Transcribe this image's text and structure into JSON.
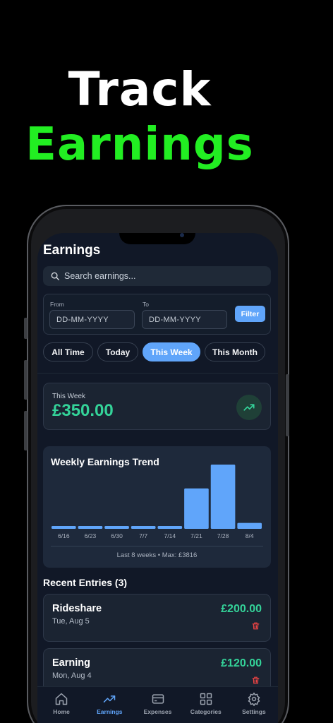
{
  "promo": {
    "line1": "Track",
    "line2": "Earnings"
  },
  "app": {
    "title": "Earnings",
    "search_placeholder": "Search earnings..."
  },
  "date_filter": {
    "from_label": "From",
    "from_value": "DD-MM-YYYY",
    "to_label": "To",
    "to_value": "DD-MM-YYYY",
    "filter_button": "Filter"
  },
  "chips": [
    {
      "label": "All Time",
      "active": false
    },
    {
      "label": "Today",
      "active": false
    },
    {
      "label": "This Week",
      "active": true
    },
    {
      "label": "This Month",
      "active": false
    }
  ],
  "summary": {
    "label": "This Week",
    "amount": "£350.00",
    "icon": "trending-up-icon"
  },
  "chart_data": {
    "type": "bar",
    "title": "Weekly Earnings Trend",
    "categories": [
      "6/16",
      "6/23",
      "6/30",
      "7/7",
      "7/14",
      "7/21",
      "7/28",
      "8/4"
    ],
    "values": [
      150,
      150,
      150,
      150,
      150,
      2400,
      3816,
      350
    ],
    "ylim": [
      0,
      3816
    ],
    "footer": "Last 8 weeks • Max: £3816",
    "bar_color": "#60a5fa"
  },
  "recent": {
    "title": "Recent Entries (3)",
    "entries": [
      {
        "name": "Rideshare",
        "date": "Tue, Aug 5",
        "amount": "£200.00"
      },
      {
        "name": "Earning",
        "date": "Mon, Aug 4",
        "amount": "£120.00"
      }
    ]
  },
  "tabs": [
    {
      "label": "Home",
      "icon": "home-icon",
      "active": false
    },
    {
      "label": "Earnings",
      "icon": "trending-up-icon",
      "active": true
    },
    {
      "label": "Expenses",
      "icon": "credit-card-icon",
      "active": false
    },
    {
      "label": "Categories",
      "icon": "grid-icon",
      "active": false
    },
    {
      "label": "Settings",
      "icon": "gear-icon",
      "active": false
    }
  ],
  "colors": {
    "accent": "#60a5fa",
    "positive": "#34d399",
    "headline_green": "#22ee22",
    "danger": "#ef4444"
  }
}
